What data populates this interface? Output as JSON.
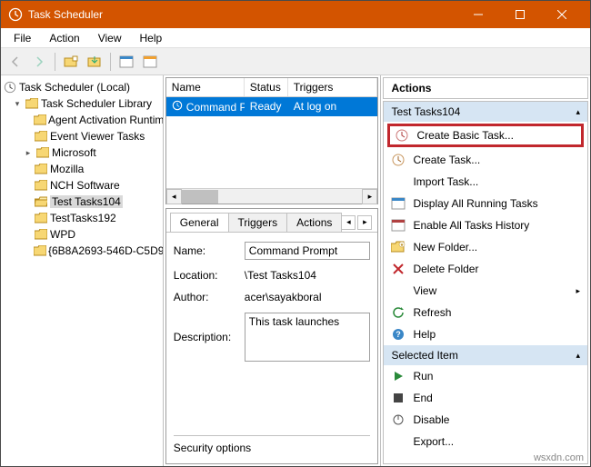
{
  "window": {
    "title": "Task Scheduler"
  },
  "menu": {
    "file": "File",
    "action": "Action",
    "view": "View",
    "help": "Help"
  },
  "tree": {
    "root": "Task Scheduler (Local)",
    "library": "Task Scheduler Library",
    "items": [
      "Agent Activation Runtime",
      "Event Viewer Tasks",
      "Microsoft",
      "Mozilla",
      "NCH Software",
      "Test Tasks104",
      "TestTasks192",
      "WPD",
      "{6B8A2693-546D-C5D9"
    ]
  },
  "task_list": {
    "cols": {
      "name": "Name",
      "status": "Status",
      "triggers": "Triggers"
    },
    "row": {
      "name": "Command P...",
      "status": "Ready",
      "triggers": "At log on"
    }
  },
  "details": {
    "tabs": {
      "general": "General",
      "triggers": "Triggers",
      "actions": "Actions"
    },
    "name_lbl": "Name:",
    "name_val": "Command Prompt",
    "loc_lbl": "Location:",
    "loc_val": "\\Test Tasks104",
    "auth_lbl": "Author:",
    "auth_val": "acer\\sayakboral",
    "desc_lbl": "Description:",
    "desc_val": "This task launches",
    "sec_lbl": "Security options"
  },
  "actions": {
    "title": "Actions",
    "group1": "Test Tasks104",
    "create_basic": "Create Basic Task...",
    "create_task": "Create Task...",
    "import_task": "Import Task...",
    "display_running": "Display All Running Tasks",
    "enable_history": "Enable All Tasks History",
    "new_folder": "New Folder...",
    "delete_folder": "Delete Folder",
    "view": "View",
    "refresh": "Refresh",
    "help": "Help",
    "group2": "Selected Item",
    "run": "Run",
    "end": "End",
    "disable": "Disable",
    "export": "Export..."
  },
  "watermark": "wsxdn.com"
}
